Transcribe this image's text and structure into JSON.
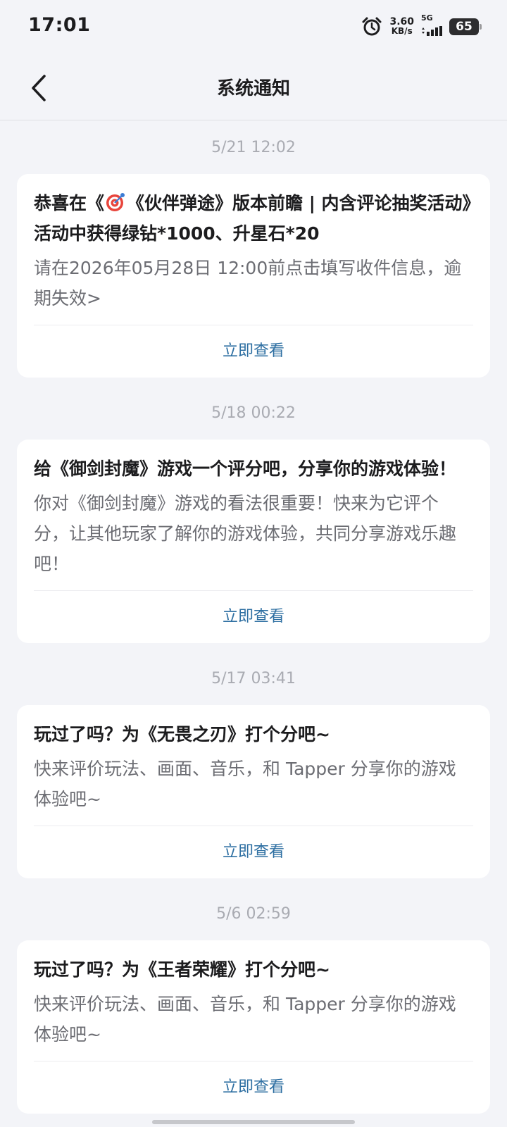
{
  "status_bar": {
    "time": "17:01",
    "net_speed_value": "3.60",
    "net_speed_unit": "KB/s",
    "network_type": "5G",
    "battery": "65"
  },
  "header": {
    "title": "系统通知",
    "back_icon": "chevron-left-icon"
  },
  "notifications": [
    {
      "timestamp": "5/21  12:02",
      "title_prefix": "恭喜在《",
      "title_emoji": "target-emoji-icon",
      "title_rest": "《伙伴弹途》版本前瞻 | 内含评论抽奖活动》活动中获得绿钻*1000、升星石*20",
      "body": "请在2026年05月28日 12:00前点击填写收件信息，逾期失效>",
      "action": "立即查看"
    },
    {
      "timestamp": "5/18  00:22",
      "title": "给《御剑封魔》游戏一个评分吧，分享你的游戏体验！",
      "body": "你对《御剑封魔》游戏的看法很重要！快来为它评个分，让其他玩家了解你的游戏体验，共同分享游戏乐趣吧！",
      "action": "立即查看"
    },
    {
      "timestamp": "5/17  03:41",
      "title": "玩过了吗？为《无畏之刃》打个分吧~",
      "body": "快来评价玩法、画面、音乐，和 Tapper 分享你的游戏体验吧~",
      "action": "立即查看"
    },
    {
      "timestamp": "5/6  02:59",
      "title": "玩过了吗？为《王者荣耀》打个分吧~",
      "body": "快来评价玩法、画面、音乐，和 Tapper 分享你的游戏体验吧~",
      "action": "立即查看"
    }
  ],
  "colors": {
    "background": "#f3f4f8",
    "card": "#ffffff",
    "action_link": "#2e6fa2",
    "timestamp": "#a9abb2",
    "body_text": "#6c6d73"
  }
}
